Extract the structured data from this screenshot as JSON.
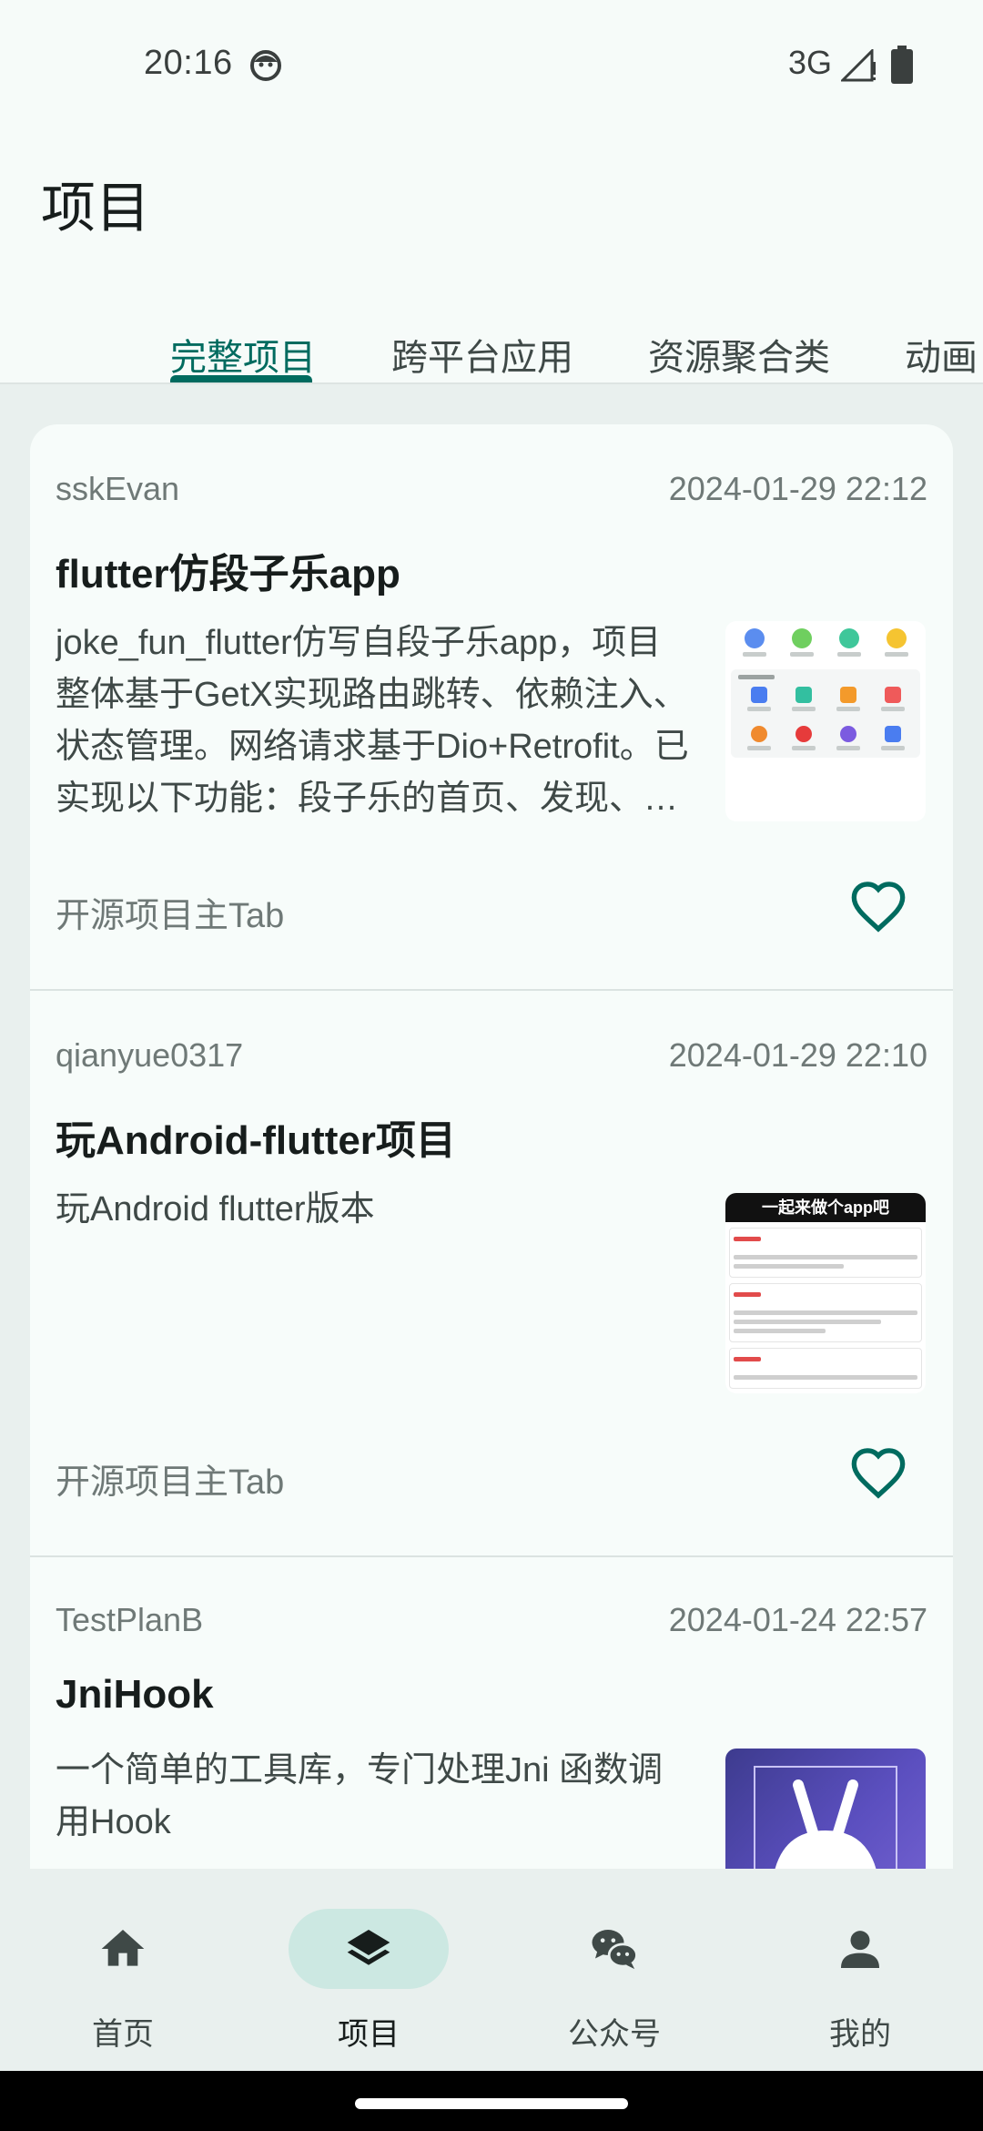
{
  "status_bar": {
    "time": "20:16",
    "network": "3G"
  },
  "header": {
    "title": "项目"
  },
  "tabs": [
    {
      "label": "完整项目",
      "active": true
    },
    {
      "label": "跨平台应用",
      "active": false
    },
    {
      "label": "资源聚合类",
      "active": false
    },
    {
      "label": "动画",
      "active": false
    }
  ],
  "cards": [
    {
      "author": "sskEvan",
      "date": "2024-01-29 22:12",
      "title": "flutter仿段子乐app",
      "desc": "joke_fun_flutter仿写自段子乐app，项目整体基于GetX实现路由跳转、依赖注入、状态管理。网络请求基于Dio+Retrofit。已实现以下功能：段子乐的首页、发现、消息、我的等等功能模块。",
      "chapter": "开源项目主Tab",
      "favorite_icon": "heart-outline-icon"
    },
    {
      "author": "qianyue0317",
      "date": "2024-01-29 22:10",
      "title": "玩Android-flutter项目",
      "desc": "玩Android flutter版本",
      "chapter": "开源项目主Tab",
      "favorite_icon": "heart-outline-icon",
      "thumb_banner": "一起来做个app吧"
    },
    {
      "author": "TestPlanB",
      "date": "2024-01-24 22:57",
      "title": "JniHook",
      "desc": "一个简单的工具库，专门处理Jni 函数调用Hook",
      "chapter": "",
      "favorite_icon": "heart-outline-icon"
    }
  ],
  "bottom_nav": [
    {
      "label": "首页",
      "icon": "home-icon",
      "active": false
    },
    {
      "label": "项目",
      "icon": "layers-icon",
      "active": true
    },
    {
      "label": "公众号",
      "icon": "wechat-icon",
      "active": false
    },
    {
      "label": "我的",
      "icon": "person-icon",
      "active": false
    }
  ],
  "colors": {
    "accent": "#006b5f",
    "background": "#f6fbf9",
    "surface": "#e9f0ee",
    "active_pill": "#cce8e2"
  }
}
